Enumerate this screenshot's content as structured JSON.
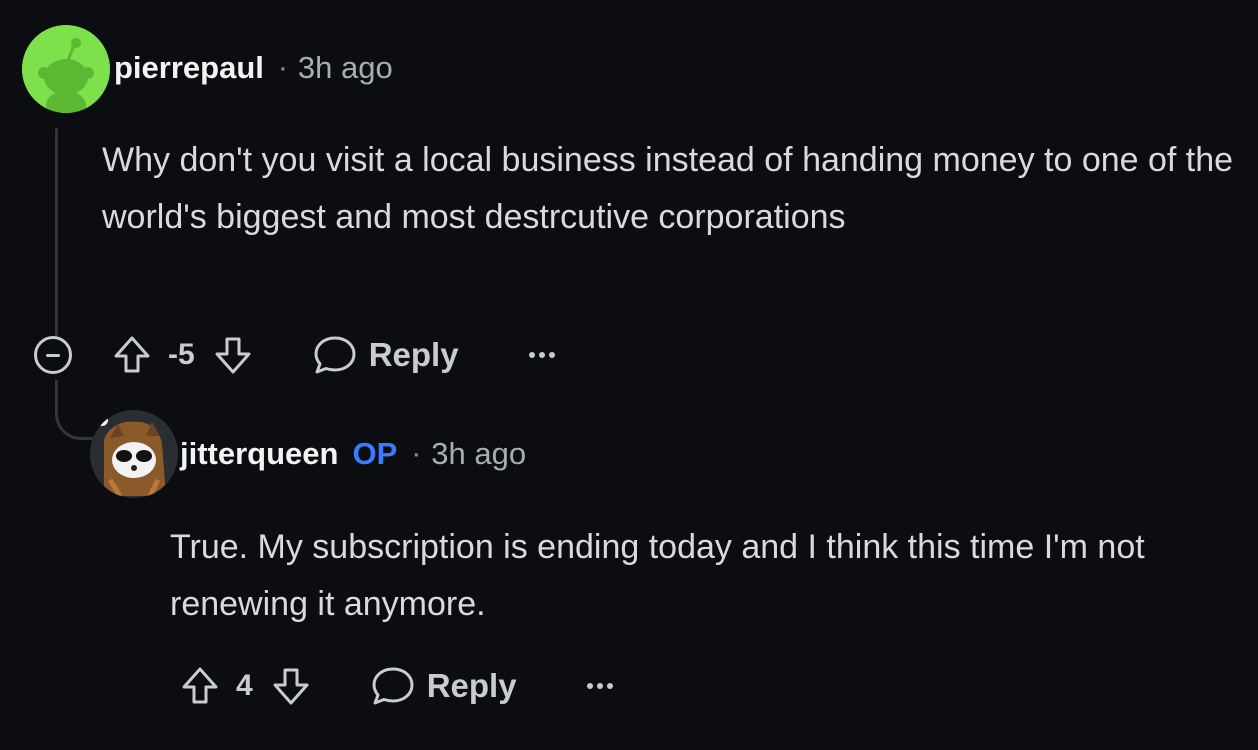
{
  "comments": [
    {
      "username": "pierrepaul",
      "separator": "·",
      "time": "3h ago",
      "body": "Why don't you visit a local business instead of handing money to one of the world's biggest and most destrcutive corporations",
      "score": "-5",
      "reply_label": "Reply",
      "avatar_color": "#7ee04a",
      "icons": [
        "collapse-icon",
        "upvote-icon",
        "downvote-icon",
        "reply-bubble-icon",
        "more-options-icon"
      ]
    },
    {
      "username": "jitterqueen",
      "op_badge": "OP",
      "separator": "·",
      "time": "3h ago",
      "body": "True. My subscription is ending today and I think this time I'm not renewing it anymore.",
      "score": "4",
      "reply_label": "Reply",
      "icons": [
        "upvote-icon",
        "downvote-icon",
        "reply-bubble-icon",
        "more-options-icon"
      ]
    }
  ],
  "colors": {
    "background": "#0b0d10",
    "op_badge": "#3a7bff",
    "thread_line": "#343536"
  }
}
